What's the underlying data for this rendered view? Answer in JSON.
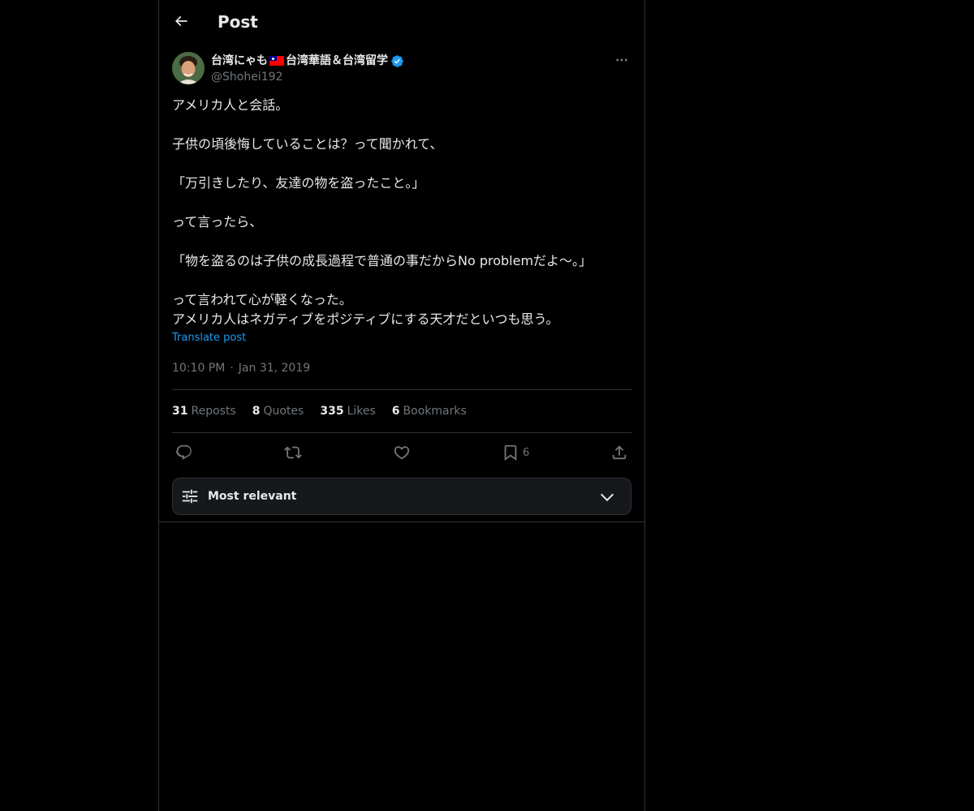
{
  "header": {
    "title": "Post",
    "back_icon": "arrow-left-icon"
  },
  "post": {
    "author": {
      "name_prefix": "台湾にゃも",
      "flag_icon": "taiwan-flag-icon",
      "name_suffix": "台湾華語＆台湾留学",
      "verified_icon": "verified-badge-icon",
      "handle": "@Shohei192"
    },
    "more_icon": "more-horizontal-icon",
    "text": "アメリカ人と会話。\n\n子供の頃後悔していることは？って聞かれて、\n\n「万引きしたり、友達の物を盗ったこと。」\n\nって言ったら、\n\n「物を盗るのは子供の成長過程で普通の事だからNo problemだよ〜。」\n\nって言われて心が軽くなった。\nアメリカ人はネガティブをポジティブにする天才だといつも思う。",
    "translate_label": "Translate post",
    "time": "10:10 PM",
    "separator": "·",
    "date": "Jan 31, 2019"
  },
  "stats": {
    "reposts": {
      "count": "31",
      "label": "Reposts"
    },
    "quotes": {
      "count": "8",
      "label": "Quotes"
    },
    "likes": {
      "count": "335",
      "label": "Likes"
    },
    "bookmarks": {
      "count": "6",
      "label": "Bookmarks"
    }
  },
  "actions": {
    "reply_icon": "reply-icon",
    "repost_icon": "repost-icon",
    "like_icon": "heart-icon",
    "bookmark_icon": "bookmark-icon",
    "bookmark_count": "6",
    "share_icon": "share-icon"
  },
  "sort": {
    "label": "Most relevant",
    "icon": "sliders-icon",
    "chevron": "chevron-down-icon"
  },
  "colors": {
    "background": "#000000",
    "text": "#e7e9ea",
    "muted": "#71767b",
    "accent": "#1d9bf0",
    "border": "#2f3336"
  }
}
